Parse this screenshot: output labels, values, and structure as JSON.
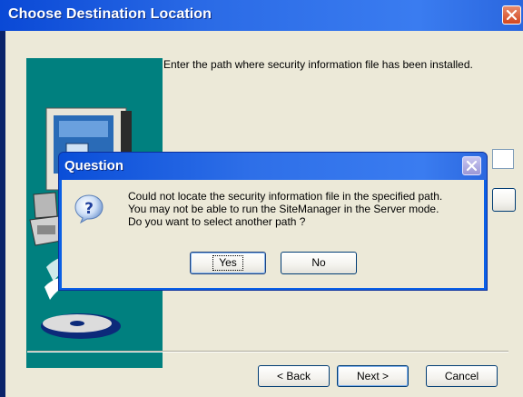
{
  "window": {
    "title": "Choose Destination Location"
  },
  "main": {
    "prompt": "Enter the path where security information file has been installed.",
    "buttons": {
      "back": "< Back",
      "next": "Next >",
      "cancel": "Cancel"
    }
  },
  "dialog": {
    "title": "Question",
    "icon": "question-icon",
    "message_lines": [
      "Could not locate the security information file in the specified path.",
      "You may not be able to run the SiteManager in the Server mode.",
      "Do you want to select another path ?"
    ],
    "buttons": {
      "yes": "Yes",
      "no": "No"
    }
  },
  "colors": {
    "titlebar": "#2b6be6",
    "panel": "#00807f",
    "dialog_face": "#ece9d8",
    "close_button": "#d2461f"
  }
}
